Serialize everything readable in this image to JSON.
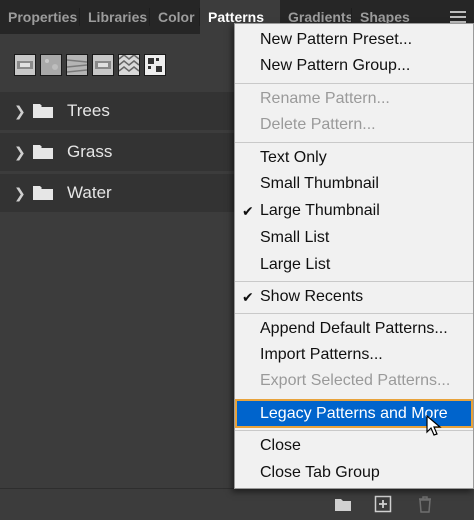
{
  "tabs": [
    {
      "label": "Properties",
      "active": false
    },
    {
      "label": "Libraries",
      "active": false
    },
    {
      "label": "Color",
      "active": false
    },
    {
      "label": "Patterns",
      "active": true
    },
    {
      "label": "Gradients",
      "active": false
    },
    {
      "label": "Shapes",
      "active": false
    }
  ],
  "panel_menu_icon": "hamburger-icon",
  "groups": [
    {
      "label": "Trees",
      "icon": "folder-icon"
    },
    {
      "label": "Grass",
      "icon": "folder-icon"
    },
    {
      "label": "Water",
      "icon": "folder-icon"
    }
  ],
  "bottom_icons": [
    "new-group-folder-icon",
    "new-pattern-icon",
    "trash-icon"
  ],
  "menu": {
    "items": [
      {
        "label": "New Pattern Preset...",
        "state": "enabled"
      },
      {
        "label": "New Pattern Group...",
        "state": "enabled"
      },
      {
        "label": "Rename Pattern...",
        "state": "disabled"
      },
      {
        "label": "Delete Pattern...",
        "state": "disabled"
      },
      {
        "label": "Text Only",
        "state": "enabled"
      },
      {
        "label": "Small Thumbnail",
        "state": "enabled"
      },
      {
        "label": "Large Thumbnail",
        "state": "checked"
      },
      {
        "label": "Small List",
        "state": "enabled"
      },
      {
        "label": "Large List",
        "state": "enabled"
      },
      {
        "label": "Show Recents",
        "state": "checked"
      },
      {
        "label": "Append Default Patterns...",
        "state": "enabled"
      },
      {
        "label": "Import Patterns...",
        "state": "enabled"
      },
      {
        "label": "Export Selected Patterns...",
        "state": "disabled"
      },
      {
        "label": "Legacy Patterns and More",
        "state": "highlighted"
      },
      {
        "label": "Close",
        "state": "enabled"
      },
      {
        "label": "Close Tab Group",
        "state": "enabled"
      }
    ],
    "check_glyph": "✔"
  },
  "colors": {
    "highlight": "#0064cc",
    "highlight_outline": "#e8a33c",
    "active_tab_text": "#ffffff"
  }
}
